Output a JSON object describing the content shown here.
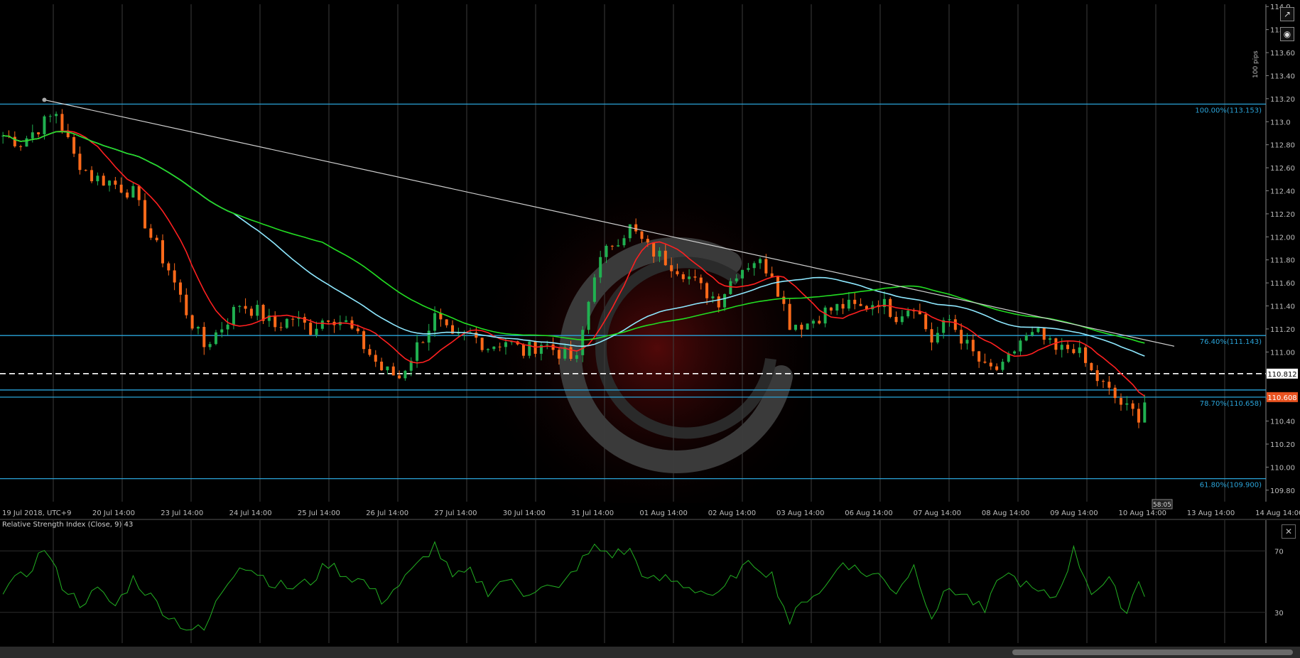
{
  "chart_data": [
    {
      "type": "candlestick",
      "instrument_note": "",
      "ylim": [
        109.7,
        114.02
      ],
      "y_ticks": [
        "114.0",
        "113.8",
        "113.60",
        "113.40",
        "113.20",
        "113.0",
        "112.80",
        "112.60",
        "112.40",
        "112.20",
        "112.00",
        "111.80",
        "111.60",
        "111.40",
        "111.20",
        "111.00",
        "110.80",
        "110.60",
        "110.40",
        "110.20",
        "110.00",
        "109.80"
      ],
      "x_ticks": [
        "19 Jul 2018, UTC+9",
        "20 Jul 14:00",
        "23 Jul 14:00",
        "24 Jul 14:00",
        "25 Jul 14:00",
        "26 Jul 14:00",
        "27 Jul 14:00",
        "30 Jul 14:00",
        "31 Jul 14:00",
        "01 Aug 14:00",
        "02 Aug 14:00",
        "03 Aug 14:00",
        "06 Aug 14:00",
        "07 Aug 14:00",
        "08 Aug 14:00",
        "09 Aug 14:00",
        "10 Aug 14:00",
        "13 Aug 14:00",
        "14 Aug 14:00"
      ],
      "pips_label": "100 pips",
      "timer_label": "58:05",
      "close_anchors": [
        [
          0,
          112.88
        ],
        [
          3,
          112.82
        ],
        [
          6,
          112.95
        ],
        [
          9,
          113.08
        ],
        [
          12,
          112.7
        ],
        [
          15,
          112.52
        ],
        [
          18,
          112.48
        ],
        [
          22,
          112.38
        ],
        [
          25,
          112.0
        ],
        [
          28,
          111.72
        ],
        [
          31,
          111.35
        ],
        [
          34,
          111.05
        ],
        [
          37,
          111.22
        ],
        [
          40,
          111.42
        ],
        [
          43,
          111.35
        ],
        [
          46,
          111.22
        ],
        [
          49,
          111.3
        ],
        [
          52,
          111.2
        ],
        [
          55,
          111.32
        ],
        [
          58,
          111.25
        ],
        [
          61,
          111.05
        ],
        [
          64,
          110.85
        ],
        [
          67,
          110.78
        ],
        [
          70,
          111.05
        ],
        [
          73,
          111.3
        ],
        [
          76,
          111.1
        ],
        [
          79,
          111.15
        ],
        [
          82,
          111.05
        ],
        [
          85,
          111.1
        ],
        [
          88,
          111.0
        ],
        [
          91,
          111.08
        ],
        [
          94,
          111.0
        ],
        [
          97,
          110.92
        ],
        [
          100,
          111.7
        ],
        [
          103,
          111.95
        ],
        [
          106,
          112.08
        ],
        [
          109,
          111.9
        ],
        [
          112,
          111.8
        ],
        [
          115,
          111.7
        ],
        [
          118,
          111.55
        ],
        [
          121,
          111.45
        ],
        [
          124,
          111.7
        ],
        [
          127,
          111.8
        ],
        [
          130,
          111.7
        ],
        [
          133,
          111.25
        ],
        [
          136,
          111.25
        ],
        [
          139,
          111.35
        ],
        [
          142,
          111.4
        ],
        [
          145,
          111.38
        ],
        [
          148,
          111.45
        ],
        [
          151,
          111.32
        ],
        [
          154,
          111.42
        ],
        [
          157,
          111.1
        ],
        [
          160,
          111.28
        ],
        [
          163,
          111.05
        ],
        [
          166,
          110.85
        ],
        [
          169,
          110.85
        ],
        [
          172,
          111.1
        ],
        [
          175,
          111.15
        ],
        [
          178,
          111.0
        ],
        [
          181,
          111.05
        ],
        [
          184,
          110.82
        ],
        [
          187,
          110.65
        ],
        [
          190,
          110.5
        ],
        [
          192,
          110.45
        ],
        [
          193,
          110.58
        ]
      ],
      "series": [
        {
          "name": "",
          "color": "#ff2020",
          "kind": "ma",
          "period": 10
        },
        {
          "name": "",
          "color": "#8ee8ff",
          "kind": "ma",
          "period": 40
        },
        {
          "name": "",
          "color": "#22dd22",
          "kind": "ma",
          "period": 55
        }
      ],
      "trendline": {
        "from": [
          7,
          113.19
        ],
        "to": [
          198,
          111.05
        ],
        "color": "#cfcfcf"
      },
      "horizontal_levels": [
        {
          "value": 113.153,
          "label": "100.00%(113.153)",
          "color": "#2aa3d8"
        },
        {
          "value": 111.143,
          "label": "76.40%(111.143)",
          "color": "#2aa3d8"
        },
        {
          "value": 110.67,
          "label": "",
          "color": "#2aa3d8"
        },
        {
          "value": 110.608,
          "label": "78.70%(110.658)",
          "color": "#2aa3d8"
        },
        {
          "value": 109.9,
          "label": "61.80%(109.900)",
          "color": "#2aa3d8"
        }
      ],
      "dashed_level": {
        "value": 110.812,
        "label": "110.812",
        "color": "#ffffff"
      },
      "price_tag": {
        "value": 110.608,
        "label": "110.608",
        "color": "#e8521f"
      },
      "up_color": "#20b050",
      "down_color": "#ff6a1a"
    },
    {
      "type": "line",
      "title": "Relative Strength Index (Close, 9) 43",
      "ylim": [
        10,
        90
      ],
      "y_ticks": [
        "70",
        "30"
      ],
      "levels": [
        70,
        30
      ],
      "series": [
        {
          "name": "",
          "color": "#22b022",
          "anchors": [
            [
              0,
              45
            ],
            [
              4,
              55
            ],
            [
              7,
              72
            ],
            [
              10,
              48
            ],
            [
              13,
              36
            ],
            [
              16,
              44
            ],
            [
              19,
              34
            ],
            [
              22,
              52
            ],
            [
              25,
              40
            ],
            [
              28,
              28
            ],
            [
              31,
              20
            ],
            [
              34,
              18
            ],
            [
              37,
              44
            ],
            [
              40,
              62
            ],
            [
              43,
              56
            ],
            [
              46,
              48
            ],
            [
              49,
              46
            ],
            [
              52,
              50
            ],
            [
              55,
              62
            ],
            [
              58,
              54
            ],
            [
              61,
              50
            ],
            [
              64,
              38
            ],
            [
              67,
              48
            ],
            [
              70,
              60
            ],
            [
              73,
              74
            ],
            [
              76,
              52
            ],
            [
              79,
              56
            ],
            [
              82,
              44
            ],
            [
              85,
              52
            ],
            [
              88,
              42
            ],
            [
              91,
              48
            ],
            [
              94,
              44
            ],
            [
              97,
              60
            ],
            [
              100,
              72
            ],
            [
              103,
              68
            ],
            [
              106,
              70
            ],
            [
              109,
              50
            ],
            [
              112,
              52
            ],
            [
              115,
              48
            ],
            [
              118,
              44
            ],
            [
              121,
              40
            ],
            [
              124,
              56
            ],
            [
              127,
              62
            ],
            [
              130,
              54
            ],
            [
              133,
              24
            ],
            [
              136,
              40
            ],
            [
              139,
              46
            ],
            [
              142,
              64
            ],
            [
              145,
              56
            ],
            [
              148,
              54
            ],
            [
              151,
              44
            ],
            [
              154,
              60
            ],
            [
              157,
              28
            ],
            [
              160,
              46
            ],
            [
              163,
              40
            ],
            [
              166,
              30
            ],
            [
              169,
              56
            ],
            [
              172,
              50
            ],
            [
              175,
              42
            ],
            [
              178,
              40
            ],
            [
              181,
              70
            ],
            [
              184,
              44
            ],
            [
              187,
              50
            ],
            [
              190,
              30
            ],
            [
              192,
              52
            ],
            [
              193,
              43
            ]
          ]
        }
      ]
    }
  ]
}
